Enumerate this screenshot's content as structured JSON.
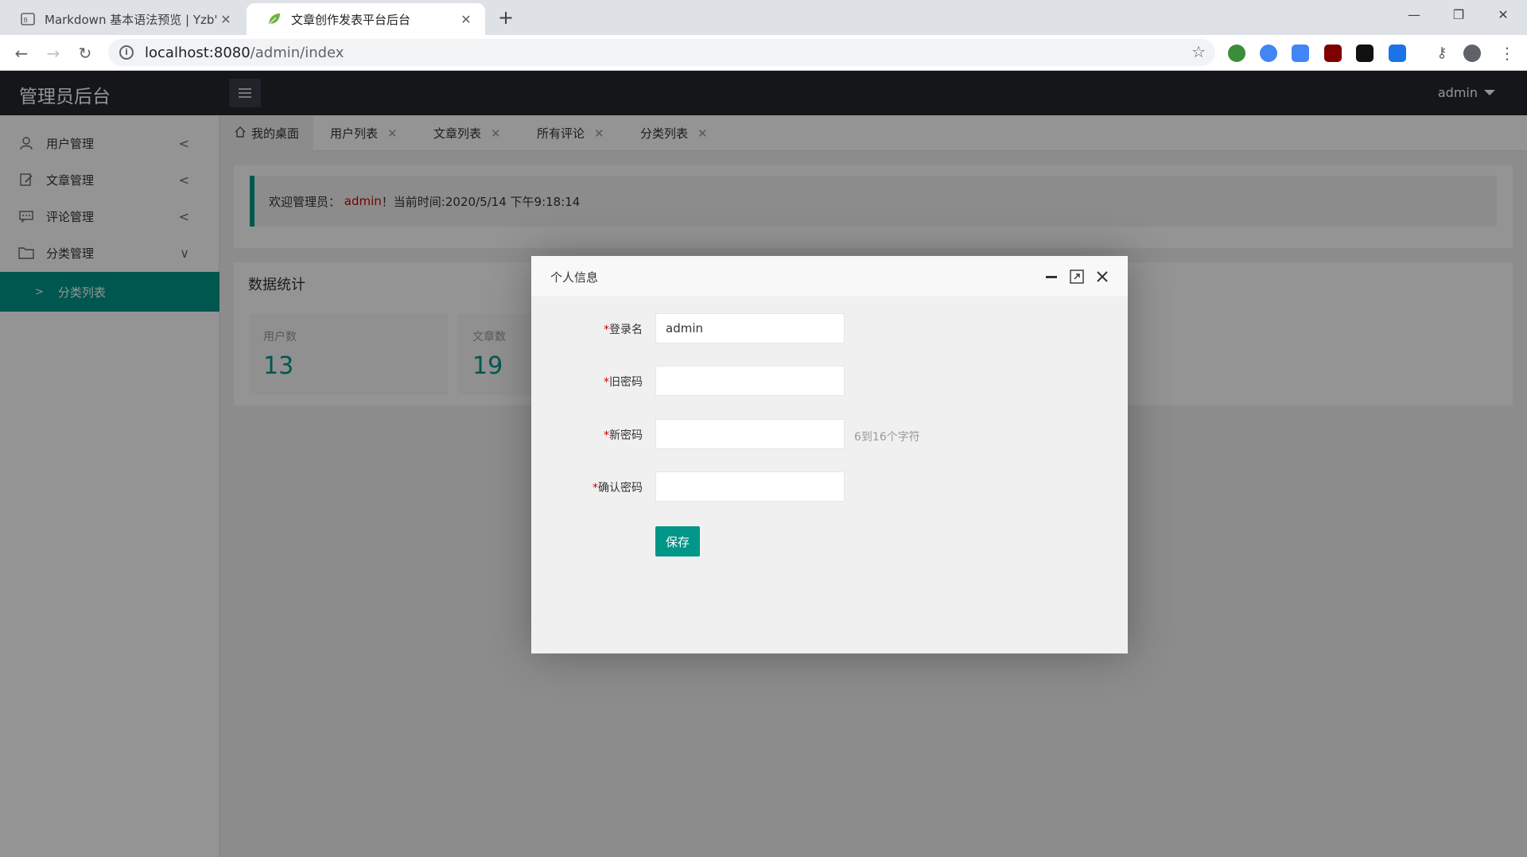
{
  "browser": {
    "tabs": [
      {
        "title": "Markdown 基本语法预览 | Yzb'",
        "active": false
      },
      {
        "title": "文章创作发表平台后台",
        "active": true
      }
    ],
    "url_host": "localhost:8080",
    "url_path": "/admin/index",
    "extension_badge": "3"
  },
  "app": {
    "logo": "管理员后台",
    "user": "admin"
  },
  "sidebar": {
    "items": [
      {
        "label": "用户管理",
        "icon": "user-icon"
      },
      {
        "label": "文章管理",
        "icon": "edit-icon"
      },
      {
        "label": "评论管理",
        "icon": "comment-icon"
      },
      {
        "label": "分类管理",
        "icon": "folder-icon"
      }
    ],
    "sub_item": "分类列表"
  },
  "page_tabs": [
    "我的桌面",
    "用户列表",
    "文章列表",
    "所有评论",
    "分类列表"
  ],
  "welcome": {
    "prefix": "欢迎管理员：",
    "username": "admin",
    "suffix": "！当前时间:2020/5/14 下午9:18:14"
  },
  "stats": {
    "title": "数据统计",
    "cards": [
      {
        "label": "用户数",
        "value": "13"
      },
      {
        "label": "文章数",
        "value": "19"
      }
    ]
  },
  "modal": {
    "title": "个人信息",
    "fields": [
      {
        "label": "登录名",
        "value": "admin",
        "hint": ""
      },
      {
        "label": "旧密码",
        "value": "",
        "hint": ""
      },
      {
        "label": "新密码",
        "value": "",
        "hint": "6到16个字符"
      },
      {
        "label": "确认密码",
        "value": "",
        "hint": ""
      }
    ],
    "required_mark": "*",
    "save_label": "保存"
  },
  "colors": {
    "accent": "#009688",
    "header": "#23262e",
    "highlight": "#cc0000"
  }
}
